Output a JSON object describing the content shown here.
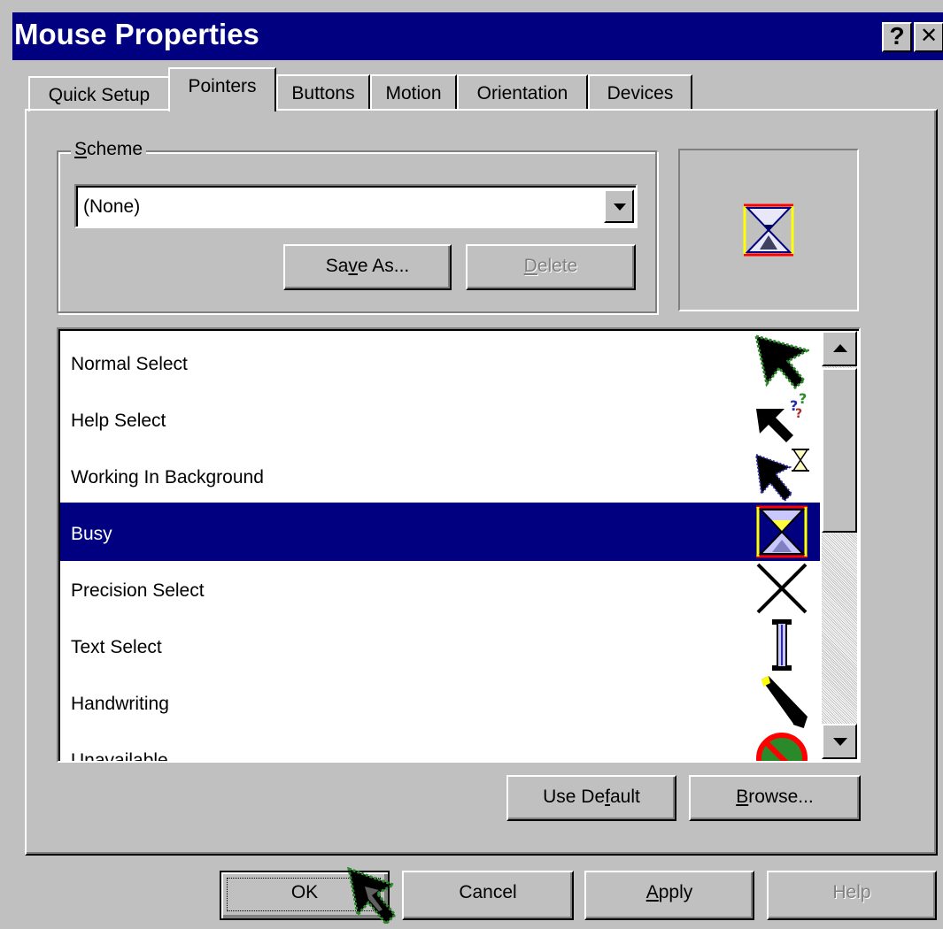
{
  "window": {
    "title": "Mouse Properties",
    "help_glyph": "?",
    "close_glyph": "✕"
  },
  "tabs": [
    {
      "label": "Quick Setup",
      "active": false
    },
    {
      "label": "Pointers",
      "active": true
    },
    {
      "label": "Buttons",
      "active": false
    },
    {
      "label": "Motion",
      "active": false
    },
    {
      "label": "Orientation",
      "active": false
    },
    {
      "label": "Devices",
      "active": false
    }
  ],
  "scheme": {
    "label_mnemonic": "S",
    "label_rest": "cheme",
    "selected": "(None)",
    "save_as_pre": "Sa",
    "save_as_mnemonic": "v",
    "save_as_post": "e As...",
    "delete_mnemonic": "D",
    "delete_rest": "elete"
  },
  "pointers": [
    {
      "label": "Normal Select",
      "icon": "arrow-cursor-icon",
      "selected": false
    },
    {
      "label": "Help Select",
      "icon": "help-cursor-icon",
      "selected": false
    },
    {
      "label": "Working In Background",
      "icon": "working-cursor-icon",
      "selected": false
    },
    {
      "label": "Busy",
      "icon": "hourglass-cursor-icon",
      "selected": true
    },
    {
      "label": "Precision Select",
      "icon": "crosshair-cursor-icon",
      "selected": false
    },
    {
      "label": "Text Select",
      "icon": "ibeam-cursor-icon",
      "selected": false
    },
    {
      "label": "Handwriting",
      "icon": "pen-cursor-icon",
      "selected": false
    },
    {
      "label": "Unavailable",
      "icon": "unavailable-cursor-icon",
      "selected": false
    }
  ],
  "list_buttons": {
    "use_default_pre": "Use De",
    "use_default_mnemonic": "f",
    "use_default_post": "ault",
    "browse_mnemonic": "B",
    "browse_rest": "rowse..."
  },
  "dialog_buttons": {
    "ok": "OK",
    "cancel": "Cancel",
    "apply_mnemonic": "A",
    "apply_rest": "pply",
    "help": "Help"
  },
  "colors": {
    "title_bar": "#000080",
    "face": "#c0c0c0",
    "selection": "#000080"
  }
}
